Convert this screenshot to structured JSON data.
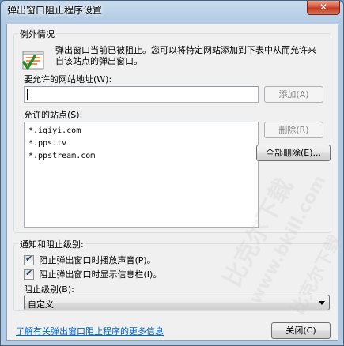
{
  "window": {
    "title": "弹出窗口阻止程序设置",
    "close_label": "✕"
  },
  "exceptions": {
    "group_label": "例外情况",
    "description": "弹出窗口当前已被阻止。您可以将特定网站添加到下表中从而允许来自该站点的弹出窗口。",
    "address_label": "要允许的网站地址(W):",
    "address_value": "",
    "add_button": "添加(A)",
    "allowed_sites_label": "允许的站点(S):",
    "allowed_sites": [
      "*.iqiyi.com",
      "*.pps.tv",
      "*.ppstream.com"
    ],
    "remove_button": "删除(R)",
    "remove_all_button": "全部删除(E)..."
  },
  "notifications": {
    "group_label": "通知和阻止级别:",
    "play_sound_label": "阻止弹出窗口时播放声音(P)。",
    "play_sound_checked": true,
    "show_infobar_label": "阻止弹出窗口时显示信息栏(I)。",
    "show_infobar_checked": true,
    "level_label": "阻止级别(B):",
    "level_value": "自定义"
  },
  "footer": {
    "learn_more_link": "了解有关弹出窗口阻止程序的更多信息",
    "close_button": "关闭(C)"
  },
  "watermark": {
    "text1": "比克尔下载",
    "text2": "www.bkill.com",
    "text3": "比克尔下载"
  },
  "icons": {
    "shield": "shield-check-icon",
    "check": "checkmark-icon",
    "dropdown": "chevron-down-icon"
  }
}
